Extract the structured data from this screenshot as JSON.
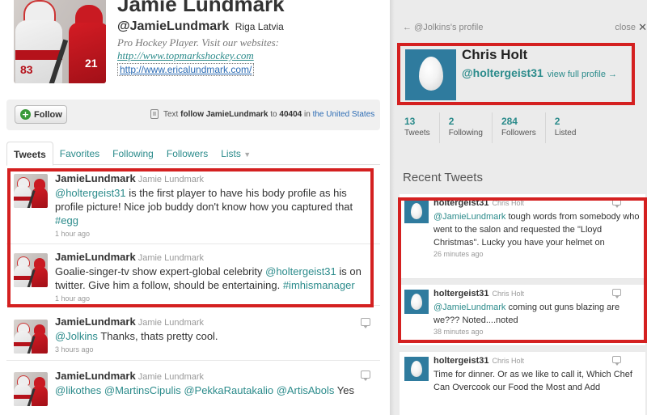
{
  "profile": {
    "name": "Jamie Lundmark",
    "handle": "@JamieLundmark",
    "location": "Riga Latvia",
    "bio": "Pro Hockey Player. Visit our websites:",
    "website1": "http://www.topmarkshockey.com",
    "website2": "http://www.ericalundmark.com/"
  },
  "follow_bar": {
    "follow_label": "Follow",
    "text_prefix": "Text",
    "text_follow": "follow JamieLundmark",
    "text_to": "to",
    "shortcode": "40404",
    "text_in": "in",
    "country": "the United States"
  },
  "tabs": [
    {
      "label": "Tweets"
    },
    {
      "label": "Favorites"
    },
    {
      "label": "Following"
    },
    {
      "label": "Followers"
    },
    {
      "label": "Lists",
      "caret": "▼"
    }
  ],
  "tweets": [
    {
      "user": "JamieLundmark",
      "full": "Jamie Lundmark",
      "p1": "@holtergeist31",
      "p2": " is the first player to have his body profile as his profile picture! Nice job buddy don't know how you captured that ",
      "p3": "#egg",
      "time": "1 hour ago"
    },
    {
      "user": "JamieLundmark",
      "full": "Jamie Lundmark",
      "p1": "Goalie-singer-tv show expert-global celebrity ",
      "p2": "@holtergeist31",
      "p3": " is on twitter. Give him a follow, should be entertaining. ",
      "p4": "#imhismanager",
      "time": "1 hour ago"
    },
    {
      "user": "JamieLundmark",
      "full": "Jamie Lundmark",
      "p1": "@Jolkins",
      "p2": " Thanks, thats pretty cool.",
      "time": "3 hours ago"
    },
    {
      "user": "JamieLundmark",
      "full": "Jamie Lundmark",
      "p1": "@likothes @MartinsCipulis @PekkaRautakalio @ArtisAbols",
      "p2": " Yes"
    }
  ],
  "panel": {
    "back_label": "← @Jolkins's profile",
    "close_label": "close",
    "close_icon": "✕",
    "name": "Chris Holt",
    "handle": "@holtergeist31",
    "view_full": "view full profile →",
    "stats": [
      {
        "n": "13",
        "l": "Tweets"
      },
      {
        "n": "2",
        "l": "Following"
      },
      {
        "n": "284",
        "l": "Followers"
      },
      {
        "n": "2",
        "l": "Listed"
      }
    ],
    "recent_title": "Recent Tweets",
    "recent": [
      {
        "user": "holtergeist31",
        "full": "Chris Holt",
        "p1": "@JamieLundmark",
        "p2": " tough words from somebody who went to the salon and requested the \"Lloyd Christmas\". Lucky you have your helmet on",
        "time": "26 minutes ago"
      },
      {
        "user": "holtergeist31",
        "full": "Chris Holt",
        "p1": "@JamieLundmark",
        "p2": " coming out guns blazing are we??? Noted....noted",
        "time": "38 minutes ago"
      },
      {
        "user": "holtergeist31",
        "full": "Chris Holt",
        "p1": "",
        "p2": "Time for dinner. Or as we like to call it, Which Chef Can Overcook our Food the Most and Add"
      }
    ]
  },
  "colors": {
    "link": "#2b8b8b",
    "highlight": "#d42020",
    "egg_background": "#2f7b9e"
  }
}
